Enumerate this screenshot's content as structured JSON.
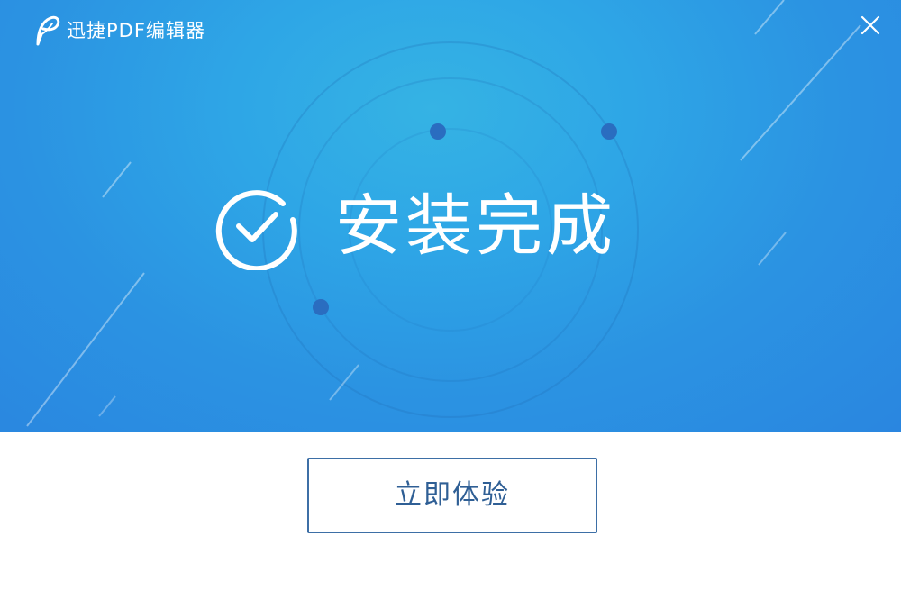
{
  "window": {
    "title": "迅捷PDF编辑器",
    "close_icon": "close-icon",
    "logo_icon": "feather-pdf-logo"
  },
  "main": {
    "status_icon": "check-circle-icon",
    "status_text": "安装完成"
  },
  "footer": {
    "primary_button_label": "立即体验"
  },
  "colors": {
    "banner_top": "#35b3e4",
    "banner_bottom": "#2a86e0",
    "button_border": "#3d6fa6",
    "button_text": "#2f5f95",
    "dot": "#2a6dc0"
  }
}
